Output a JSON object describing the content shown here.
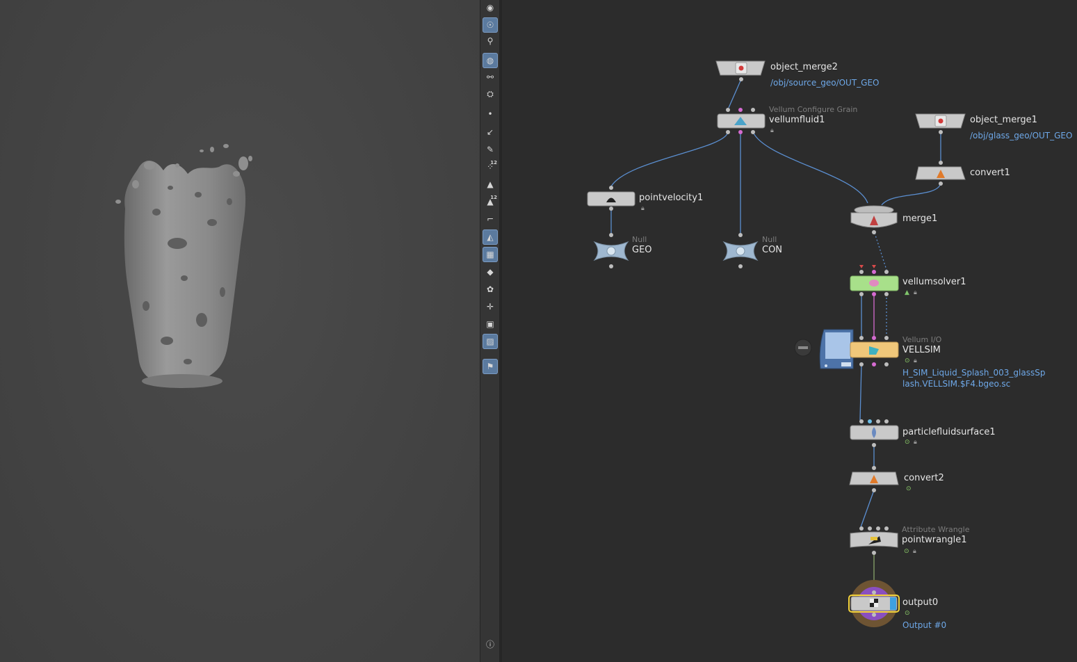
{
  "viewport": {
    "subject": "liquid-splash-mesh"
  },
  "toolbar": {
    "tools": [
      {
        "name": "select-mode-icon",
        "glyph": "◉",
        "active": false
      },
      {
        "name": "view-camera-icon",
        "glyph": "☉",
        "active": true
      },
      {
        "name": "snap-icon",
        "glyph": "⚲",
        "active": false
      },
      {
        "name": "lighting-icon",
        "glyph": "◍",
        "active": true
      },
      {
        "name": "display-options-icon",
        "glyph": "⚯",
        "active": false
      },
      {
        "name": "handles-icon",
        "glyph": "⛭",
        "active": false
      },
      {
        "name": "points-icon",
        "glyph": "•",
        "active": false
      },
      {
        "name": "normals-icon",
        "glyph": "↙",
        "active": false
      },
      {
        "name": "brush-icon",
        "glyph": "✎",
        "active": false
      },
      {
        "name": "point-numbers-icon",
        "glyph": "⁘",
        "active": false,
        "sub": "12"
      },
      {
        "name": "primitive-icon",
        "glyph": "▲",
        "active": false
      },
      {
        "name": "primitive-numbers-icon",
        "glyph": "▲",
        "active": false,
        "sub": "12"
      },
      {
        "name": "edge-icon",
        "glyph": "⌐",
        "active": false
      },
      {
        "name": "wireframe-icon",
        "glyph": "◭",
        "active": true
      },
      {
        "name": "checker-icon",
        "glyph": "▦",
        "active": true
      },
      {
        "name": "shaded-icon",
        "glyph": "◆",
        "active": false
      },
      {
        "name": "texture-icon",
        "glyph": "✿",
        "active": false
      },
      {
        "name": "pivot-icon",
        "glyph": "✛",
        "active": false
      },
      {
        "name": "frame-icon",
        "glyph": "▣",
        "active": false
      },
      {
        "name": "background-icon",
        "glyph": "▨",
        "active": true
      },
      {
        "name": "pin-icon",
        "glyph": "⚑",
        "active": true
      },
      {
        "name": "info-icon",
        "glyph": "ⓘ",
        "active": false
      }
    ]
  },
  "nodes": {
    "object_merge2": {
      "name": "object_merge2",
      "path": "/obj/source_geo/OUT_GEO"
    },
    "vellumfluid1": {
      "type": "Vellum Configure Grain",
      "name": "vellumfluid1"
    },
    "object_merge1": {
      "name": "object_merge1",
      "path": "/obj/glass_geo/OUT_GEO"
    },
    "convert1": {
      "name": "convert1"
    },
    "pointvelocity1": {
      "name": "pointvelocity1"
    },
    "merge1": {
      "name": "merge1"
    },
    "geo_null": {
      "type": "Null",
      "name": "GEO"
    },
    "con_null": {
      "type": "Null",
      "name": "CON"
    },
    "vellumsolver1": {
      "name": "vellumsolver1"
    },
    "vellsim": {
      "type": "Vellum I/O",
      "name": "VELLSIM",
      "file_line1": "H_SIM_Liquid_Splash_003_glassSp",
      "file_line2": "lash.VELLSIM.$F4.bgeo.sc"
    },
    "particlefluidsurface1": {
      "name": "particlefluidsurface1"
    },
    "convert2": {
      "name": "convert2"
    },
    "pointwrangle1": {
      "type": "Attribute Wrangle",
      "name": "pointwrangle1"
    },
    "output0": {
      "name": "output0",
      "label": "Output #0"
    }
  },
  "colors": {
    "wire": "#5b8fd1",
    "wire_pink": "#d56bd1",
    "node_body": "#c9c9c9",
    "solver_green": "#a8e08a",
    "io_orange": "#f0c77a",
    "output_ring": "#8b6a3e",
    "output_inner": "#8a4fc0",
    "selected_outline": "#f3d23a",
    "link_text": "#6ea8e8"
  }
}
